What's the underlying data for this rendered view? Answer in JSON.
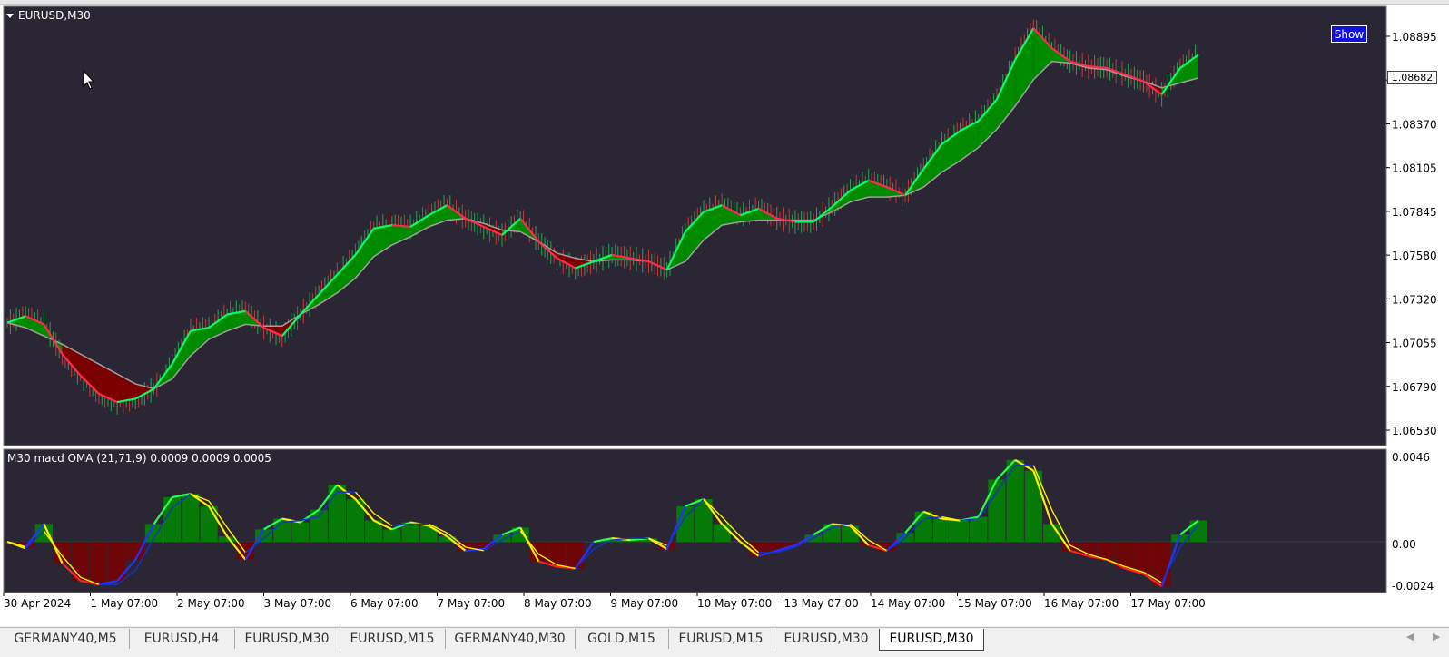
{
  "window": {
    "title": "EURUSD,M30",
    "show_button": "Show",
    "current_price": "1.08682"
  },
  "colors": {
    "background": "#2b2633",
    "bull_fill": "#008a00",
    "bear_fill": "#7a0000",
    "ma_line": "#a0a0a0",
    "bull_ma": "#00ff66",
    "bear_ma": "#ff2b4a",
    "candle_up": "#1fa84a",
    "candle_down": "#c23a3a"
  },
  "price_axis": {
    "ticks": [
      "1.08895",
      "1.08630",
      "1.08370",
      "1.08105",
      "1.07845",
      "1.07580",
      "1.07320",
      "1.07055",
      "1.06790",
      "1.06530"
    ]
  },
  "indicator": {
    "label": "M30  macd OMA (21,71,9)  0.0009 0.0009 0.0005",
    "ticks": [
      "0.0046",
      "0.00",
      "-0.0024"
    ]
  },
  "time_axis": {
    "labels": [
      "30 Apr 2024",
      "1 May 07:00",
      "2 May 07:00",
      "3 May 07:00",
      "6 May 07:00",
      "7 May 07:00",
      "8 May 07:00",
      "9 May 07:00",
      "10 May 07:00",
      "13 May 07:00",
      "14 May 07:00",
      "15 May 07:00",
      "16 May 07:00",
      "17 May 07:00"
    ]
  },
  "tabs": [
    {
      "label": "GERMANY40,M5",
      "active": false
    },
    {
      "label": "EURUSD,H4",
      "active": false
    },
    {
      "label": "EURUSD,M30",
      "active": false
    },
    {
      "label": "EURUSD,M15",
      "active": false
    },
    {
      "label": "GERMANY40,M30",
      "active": false
    },
    {
      "label": "GOLD,M15",
      "active": false
    },
    {
      "label": "EURUSD,M15",
      "active": false
    },
    {
      "label": "EURUSD,M30",
      "active": false
    },
    {
      "label": "EURUSD,M30",
      "active": true
    }
  ],
  "chart_data": {
    "type": "line",
    "price_panel": {
      "ylim": [
        1.0642,
        1.0901
      ],
      "x": [
        0,
        1,
        2,
        3,
        4,
        5,
        6,
        7,
        8,
        9,
        10,
        11,
        12,
        13,
        14,
        15,
        16,
        17,
        18,
        19,
        20,
        21,
        22,
        23,
        24,
        25,
        26,
        27,
        28,
        29,
        30,
        31,
        32,
        33,
        34,
        35,
        36,
        37,
        38,
        39,
        40,
        41,
        42,
        43,
        44,
        45,
        46,
        47,
        48,
        49,
        50,
        51,
        52,
        53,
        54,
        55,
        56,
        57,
        58,
        59,
        60,
        61,
        62,
        63,
        64,
        65
      ],
      "fast_ma": [
        1.0713,
        1.0717,
        1.0712,
        1.0694,
        1.0681,
        1.067,
        1.0665,
        1.0667,
        1.0673,
        1.0688,
        1.0708,
        1.071,
        1.0718,
        1.072,
        1.071,
        1.0705,
        1.0718,
        1.073,
        1.0742,
        1.0754,
        1.077,
        1.0772,
        1.0771,
        1.0778,
        1.0784,
        1.0776,
        1.0771,
        1.0766,
        1.0776,
        1.0762,
        1.0752,
        1.0746,
        1.075,
        1.0754,
        1.0752,
        1.075,
        1.0745,
        1.0768,
        1.078,
        1.0784,
        1.0778,
        1.0782,
        1.0776,
        1.0774,
        1.0774,
        1.0783,
        1.0793,
        1.0799,
        1.0795,
        1.079,
        1.0806,
        1.0821,
        1.0829,
        1.0835,
        1.0848,
        1.0872,
        1.0891,
        1.0879,
        1.0871,
        1.0868,
        1.0867,
        1.0863,
        1.0859,
        1.0851,
        1.0867,
        1.0875
      ],
      "slow_ma": [
        1.0713,
        1.071,
        1.0705,
        1.07,
        1.0694,
        1.0688,
        1.0682,
        1.0676,
        1.0673,
        1.0679,
        1.0693,
        1.0703,
        1.0708,
        1.0712,
        1.0711,
        1.0711,
        1.0718,
        1.0724,
        1.0731,
        1.074,
        1.0753,
        1.076,
        1.0765,
        1.0771,
        1.0775,
        1.0776,
        1.0773,
        1.0769,
        1.0768,
        1.0762,
        1.0755,
        1.0752,
        1.075,
        1.0751,
        1.0751,
        1.075,
        1.0745,
        1.075,
        1.0763,
        1.0772,
        1.0774,
        1.0775,
        1.0775,
        1.0775,
        1.0775,
        1.078,
        1.0786,
        1.0789,
        1.0789,
        1.079,
        1.0795,
        1.0804,
        1.0811,
        1.0819,
        1.083,
        1.0844,
        1.086,
        1.0871,
        1.087,
        1.0867,
        1.0866,
        1.0862,
        1.0859,
        1.0855,
        1.0858,
        1.0861
      ]
    },
    "macd_panel": {
      "ylim": [
        -0.0027,
        0.0049
      ],
      "x": [
        0,
        1,
        2,
        3,
        4,
        5,
        6,
        7,
        8,
        9,
        10,
        11,
        12,
        13,
        14,
        15,
        16,
        17,
        18,
        19,
        20,
        21,
        22,
        23,
        24,
        25,
        26,
        27,
        28,
        29,
        30,
        31,
        32,
        33,
        34,
        35,
        36,
        37,
        38,
        39,
        40,
        41,
        42,
        43,
        44,
        45,
        46,
        47,
        48,
        49,
        50,
        51,
        52,
        53,
        54,
        55,
        56,
        57,
        58,
        59,
        60,
        61,
        62,
        63,
        64,
        65
      ],
      "macd": [
        0.0,
        -0.0003,
        0.001,
        -0.0012,
        -0.0022,
        -0.0024,
        -0.0022,
        -0.001,
        0.001,
        0.0025,
        0.0027,
        0.002,
        0.0003,
        -0.001,
        0.0007,
        0.0013,
        0.0011,
        0.0018,
        0.0032,
        0.0024,
        0.0012,
        0.0007,
        0.0011,
        0.0009,
        0.0003,
        -0.0005,
        -0.0004,
        0.0004,
        0.0008,
        -0.0011,
        -0.0014,
        -0.0015,
        0.0,
        0.0002,
        0.0001,
        0.0002,
        -0.0004,
        0.002,
        0.0024,
        0.001,
        0.0,
        -0.0008,
        -0.0005,
        -0.0002,
        0.0004,
        0.001,
        0.0009,
        -0.0002,
        -0.0005,
        0.0005,
        0.0017,
        0.0013,
        0.0012,
        0.0014,
        0.0035,
        0.0046,
        0.004,
        0.001,
        -0.0005,
        -0.0008,
        -0.001,
        -0.0015,
        -0.0018,
        -0.0025,
        0.0004,
        0.0012
      ],
      "signal": [
        0.0,
        -0.0004,
        0.0006,
        -0.0008,
        -0.002,
        -0.0024,
        -0.0024,
        -0.0016,
        0.0002,
        0.0019,
        0.0027,
        0.0023,
        0.0008,
        -0.0006,
        0.0002,
        0.0011,
        0.0012,
        0.0014,
        0.0028,
        0.0028,
        0.0016,
        0.0009,
        0.001,
        0.001,
        0.0005,
        -0.0003,
        -0.0005,
        0.0001,
        0.0006,
        -0.0007,
        -0.0013,
        -0.0015,
        -0.0004,
        0.0001,
        0.0002,
        0.0002,
        -0.0002,
        0.0014,
        0.0024,
        0.0014,
        0.0003,
        -0.0006,
        -0.0006,
        -0.0003,
        0.0002,
        0.0008,
        0.001,
        0.0001,
        -0.0005,
        0.0002,
        0.0013,
        0.0014,
        0.0012,
        0.0013,
        0.0028,
        0.0043,
        0.0043,
        0.0018,
        -0.0002,
        -0.0007,
        -0.001,
        -0.0014,
        -0.0017,
        -0.0023,
        -0.0003,
        0.001
      ]
    }
  }
}
